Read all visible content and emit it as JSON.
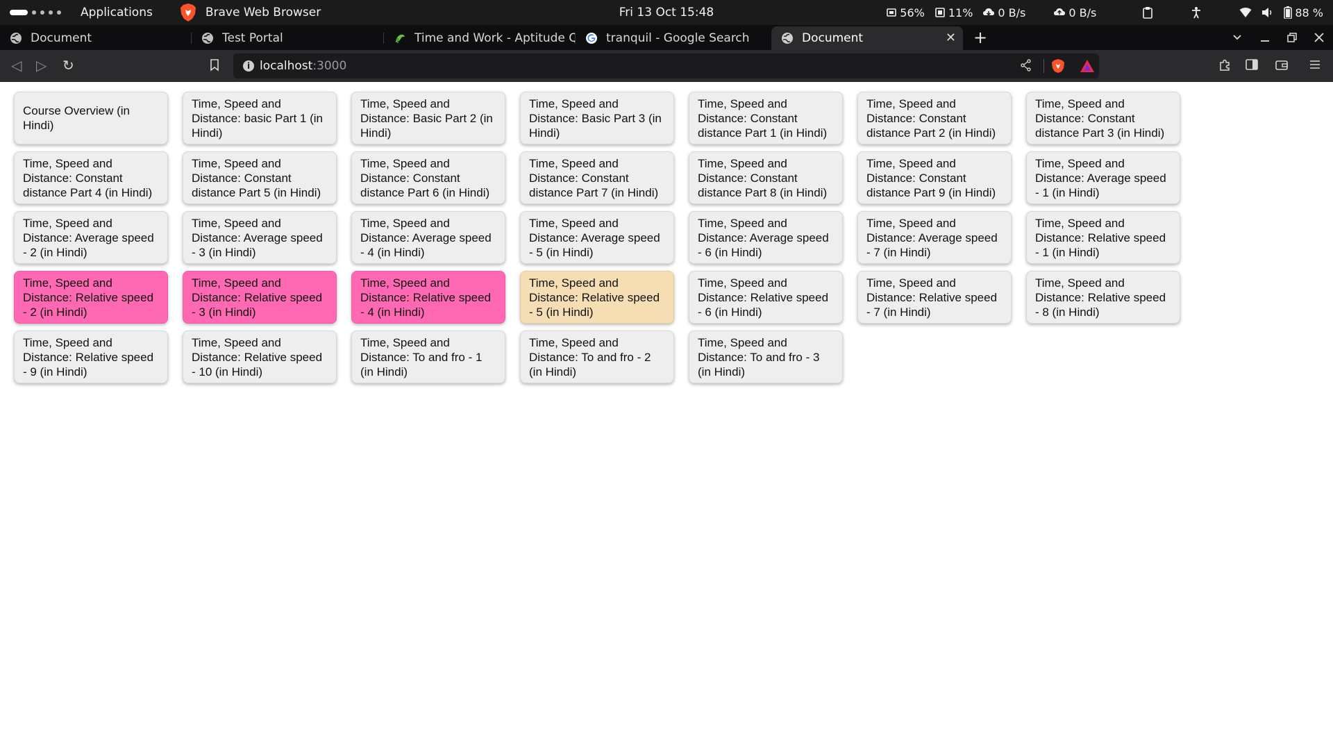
{
  "system_bar": {
    "activities": "Applications",
    "app_name": "Brave Web Browser",
    "clock": "Fri 13 Oct  15:48",
    "cpu": "56%",
    "memory": "11%",
    "net_down": "0 B/s",
    "net_up": "0 B/s",
    "battery": "88 %"
  },
  "tabs": [
    {
      "title": "Document"
    },
    {
      "title": "Test Portal"
    },
    {
      "title": "Time and Work - Aptitude Questions and Answers"
    },
    {
      "title": "tranquil - Google Search"
    },
    {
      "title": "Document"
    }
  ],
  "address_bar": {
    "host": "localhost",
    "port": ":3000"
  },
  "lectures": [
    {
      "title": "Course Overview (in Hindi)",
      "status": "default"
    },
    {
      "title": "Time, Speed and Distance: basic Part 1 (in Hindi)",
      "status": "default"
    },
    {
      "title": "Time, Speed and Distance: Basic Part 2 (in Hindi)",
      "status": "default"
    },
    {
      "title": "Time, Speed and Distance: Basic Part 3 (in Hindi)",
      "status": "default"
    },
    {
      "title": "Time, Speed and Distance: Constant distance Part 1 (in Hindi)",
      "status": "default"
    },
    {
      "title": "Time, Speed and Distance: Constant distance Part 2 (in Hindi)",
      "status": "default"
    },
    {
      "title": "Time, Speed and Distance: Constant distance Part 3 (in Hindi)",
      "status": "default"
    },
    {
      "title": "Time, Speed and Distance: Constant distance Part 4 (in Hindi)",
      "status": "default"
    },
    {
      "title": "Time, Speed and Distance: Constant distance Part 5 (in Hindi)",
      "status": "default"
    },
    {
      "title": "Time, Speed and Distance: Constant distance Part 6 (in Hindi)",
      "status": "default"
    },
    {
      "title": "Time, Speed and Distance: Constant distance Part 7 (in Hindi)",
      "status": "default"
    },
    {
      "title": "Time, Speed and Distance: Constant distance Part 8 (in Hindi)",
      "status": "default"
    },
    {
      "title": "Time, Speed and Distance: Constant distance Part 9 (in Hindi)",
      "status": "default"
    },
    {
      "title": "Time, Speed and Distance: Average speed - 1 (in Hindi)",
      "status": "default"
    },
    {
      "title": "Time, Speed and Distance: Average speed - 2 (in Hindi)",
      "status": "default"
    },
    {
      "title": "Time, Speed and Distance: Average speed - 3 (in Hindi)",
      "status": "default"
    },
    {
      "title": "Time, Speed and Distance: Average speed - 4 (in Hindi)",
      "status": "default"
    },
    {
      "title": "Time, Speed and Distance: Average speed - 5 (in Hindi)",
      "status": "default"
    },
    {
      "title": "Time, Speed and Distance: Average speed - 6 (in Hindi)",
      "status": "default"
    },
    {
      "title": "Time, Speed and Distance: Average speed - 7 (in Hindi)",
      "status": "default"
    },
    {
      "title": "Time, Speed and Distance: Relative speed - 1 (in Hindi)",
      "status": "default"
    },
    {
      "title": "Time, Speed and Distance: Relative speed - 2 (in Hindi)",
      "status": "pink"
    },
    {
      "title": "Time, Speed and Distance: Relative speed - 3 (in Hindi)",
      "status": "pink"
    },
    {
      "title": "Time, Speed and Distance: Relative speed - 4 (in Hindi)",
      "status": "pink"
    },
    {
      "title": "Time, Speed and Distance: Relative speed - 5 (in Hindi)",
      "status": "beige"
    },
    {
      "title": "Time, Speed and Distance: Relative speed - 6 (in Hindi)",
      "status": "default"
    },
    {
      "title": "Time, Speed and Distance: Relative speed - 7 (in Hindi)",
      "status": "default"
    },
    {
      "title": "Time, Speed and Distance: Relative speed - 8 (in Hindi)",
      "status": "default"
    },
    {
      "title": "Time, Speed and Distance: Relative speed - 9 (in Hindi)",
      "status": "default"
    },
    {
      "title": "Time, Speed and Distance: Relative speed - 10 (in Hindi)",
      "status": "default"
    },
    {
      "title": "Time, Speed and Distance: To and fro - 1 (in Hindi)",
      "status": "default"
    },
    {
      "title": "Time, Speed and Distance: To and fro - 2 (in Hindi)",
      "status": "default"
    },
    {
      "title": "Time, Speed and Distance: To and fro - 3 (in Hindi)",
      "status": "default"
    }
  ],
  "colors": {
    "card_default": "#eeeeee",
    "card_pink": "#ff69b4",
    "card_beige": "#f5deb3",
    "brave_orange": "#fb542b"
  }
}
